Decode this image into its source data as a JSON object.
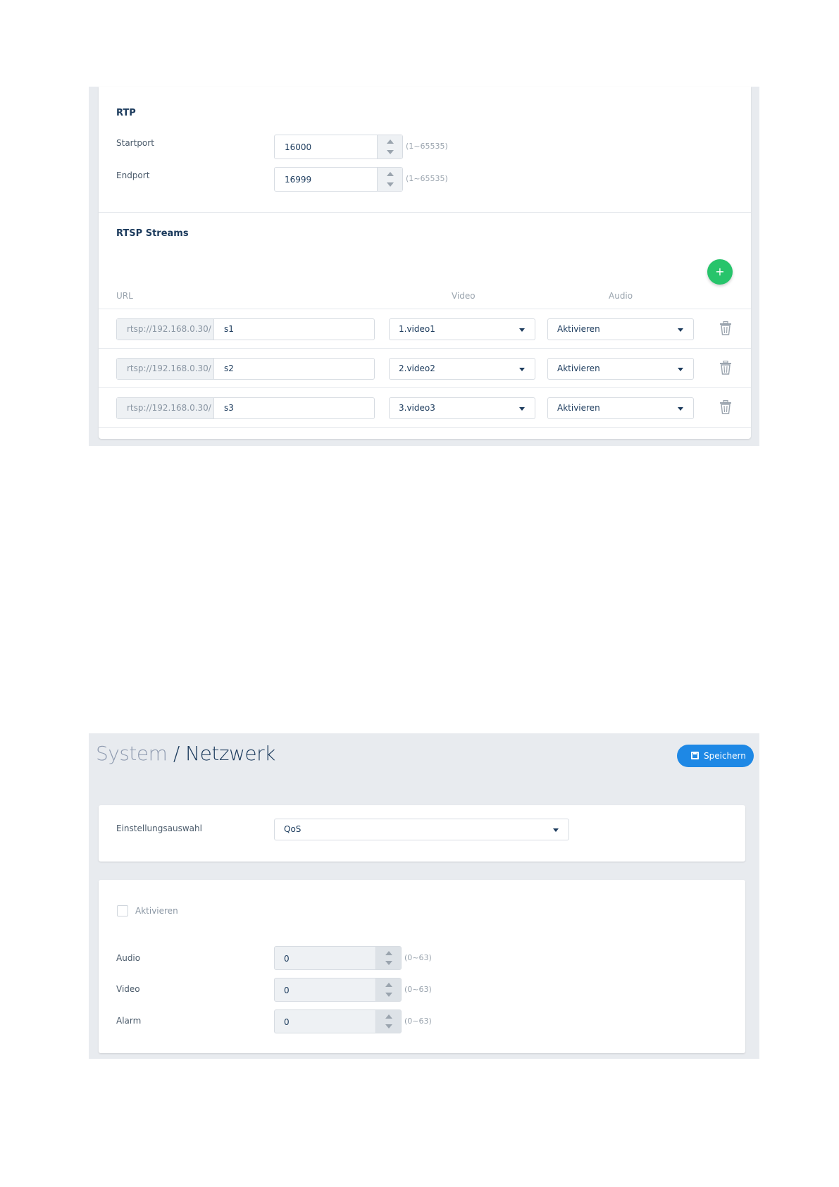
{
  "rtp": {
    "title": "RTP",
    "startport": {
      "label": "Startport",
      "value": "16000",
      "range": "(1~65535)"
    },
    "endport": {
      "label": "Endport",
      "value": "16999",
      "range": "(1~65535)"
    }
  },
  "rtsp": {
    "title": "RTSP Streams",
    "add_label": "+",
    "columns": {
      "url": "URL",
      "video": "Video",
      "audio": "Audio"
    },
    "rows": [
      {
        "prefix": "rtsp://192.168.0.30/",
        "path": "s1",
        "video": "1.video1",
        "audio": "Aktivieren"
      },
      {
        "prefix": "rtsp://192.168.0.30/",
        "path": "s2",
        "video": "2.video2",
        "audio": "Aktivieren"
      },
      {
        "prefix": "rtsp://192.168.0.30/",
        "path": "s3",
        "video": "3.video3",
        "audio": "Aktivieren"
      }
    ]
  },
  "page": {
    "crumb_parent": "System",
    "crumb_separator": "/",
    "crumb_current": "Netzwerk",
    "save_label": "Speichern"
  },
  "settings_select": {
    "label": "Einstellungsauswahl",
    "value": "QoS"
  },
  "qos": {
    "enable_label": "Aktivieren",
    "enabled": false,
    "fields": [
      {
        "label": "Audio",
        "value": "0",
        "range": "(0~63)"
      },
      {
        "label": "Video",
        "value": "0",
        "range": "(0~63)"
      },
      {
        "label": "Alarm",
        "value": "0",
        "range": "(0~63)"
      }
    ]
  },
  "colors": {
    "accent_blue": "#1e88e5",
    "add_green": "#27c46b",
    "title_navy": "#1b3a5c"
  }
}
